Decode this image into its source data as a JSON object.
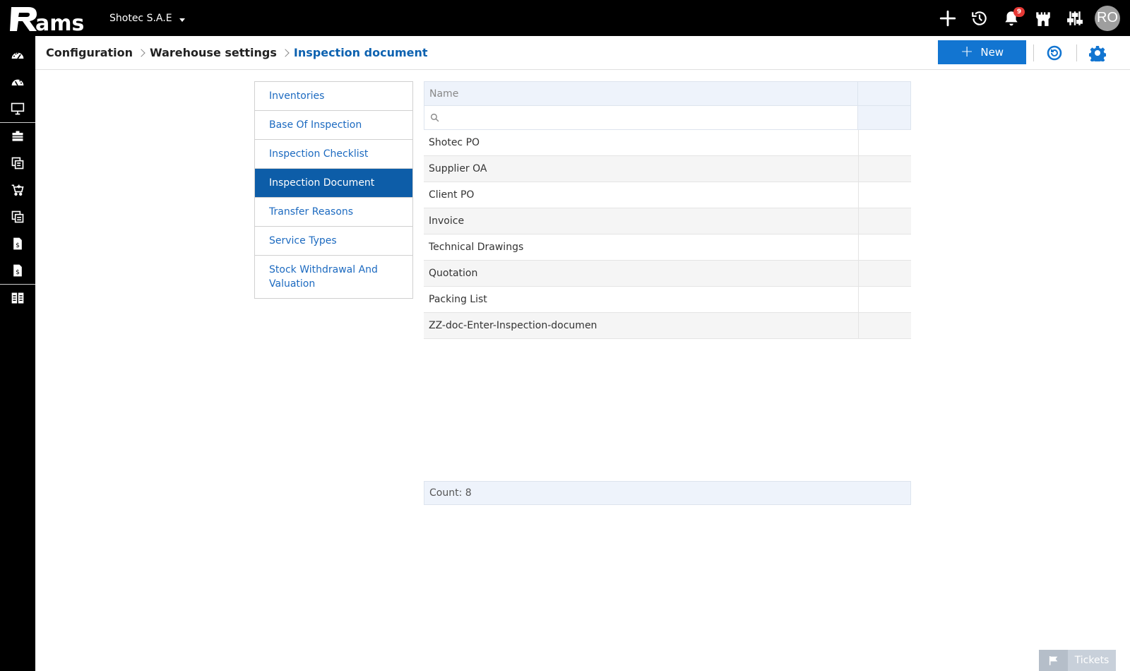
{
  "app": {
    "logo_text": "Rams",
    "company": "Shotec S.A.E"
  },
  "topbar": {
    "icons": [
      "add-icon",
      "history-icon",
      "bell-icon",
      "castle-icon",
      "sliders-icon"
    ],
    "notification_count": "9",
    "avatar_initials": "RO"
  },
  "leftrail": {
    "icons": [
      "dashboard-icon",
      "dashboard-alt-icon",
      "monitor-icon",
      "briefcase-icon",
      "items-icon",
      "cart-icon",
      "warehouse-icon",
      "invoice-icon",
      "invoice-alt-icon",
      "grid-settings-icon"
    ]
  },
  "breadcrumb": {
    "items": [
      "Configuration",
      "Warehouse settings",
      "Inspection document"
    ]
  },
  "header": {
    "new_label": "New"
  },
  "menu": {
    "items": [
      "Inventories",
      "Base Of Inspection",
      "Inspection Checklist",
      "Inspection Document",
      "Transfer Reasons",
      "Service Types",
      "Stock Withdrawal And Valuation"
    ],
    "active": "Inspection Document"
  },
  "grid": {
    "column_name": "Name",
    "filter_placeholder": "",
    "rows": [
      "Shotec PO",
      "Supplier OA",
      "Client PO",
      "Invoice",
      "Technical Drawings",
      "Quotation",
      "Packing List",
      "ZZ-doc-Enter-Inspection-documen"
    ],
    "count_label": "Count: 8"
  },
  "tickets": {
    "label": "Tickets"
  }
}
